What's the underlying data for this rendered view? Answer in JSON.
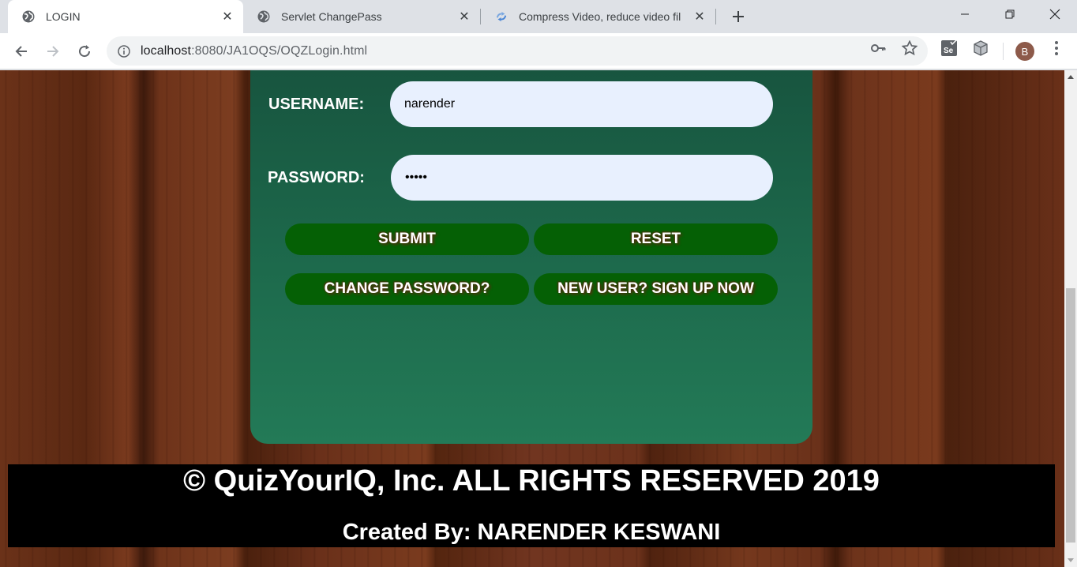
{
  "browser": {
    "tabs": [
      {
        "title": "LOGIN",
        "icon": "globe-icon",
        "active": true
      },
      {
        "title": "Servlet ChangePass",
        "icon": "globe-icon",
        "active": false
      },
      {
        "title": "Compress Video, reduce video fil",
        "icon": "compress-icon",
        "active": false
      }
    ],
    "url_host": "localhost",
    "url_rest": ":8080/JA1OQS/OQZLogin.html",
    "profile_initial": "B"
  },
  "login": {
    "username_label": "USERNAME:",
    "username_value": "narender",
    "password_label": "PASSWORD:",
    "password_value": "•••••",
    "submit_label": "SUBMIT",
    "reset_label": "RESET",
    "change_password_label": "CHANGE PASSWORD?",
    "signup_label": "NEW USER? SIGN UP NOW"
  },
  "footer": {
    "copyright": "© QuizYourIQ, Inc. ALL RIGHTS RESERVED 2019",
    "creator": "Created By: NARENDER KESWANI"
  },
  "colors": {
    "card": "#1d6a4c",
    "button": "#056005",
    "input": "#e8f0fe",
    "footer": "#000000"
  }
}
